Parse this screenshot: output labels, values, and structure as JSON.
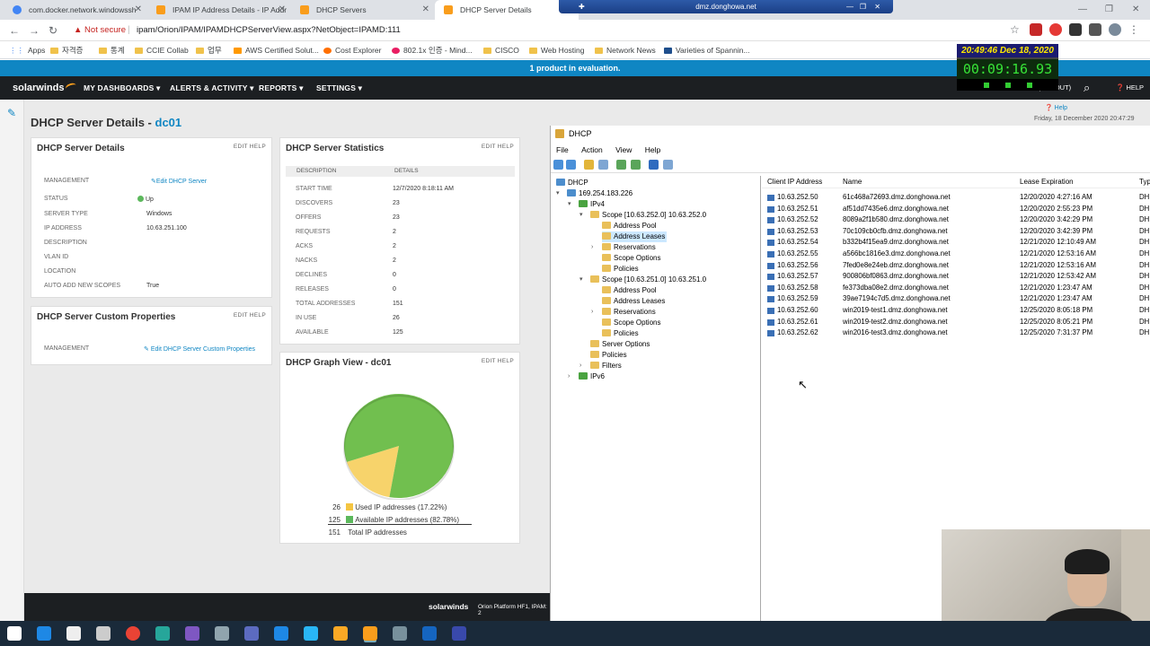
{
  "browser": {
    "tabs": [
      {
        "label": "com.docker.network.windowssh",
        "color": "#4285f4"
      },
      {
        "label": "IPAM IP Address Details - IP Addr",
        "color": "#f99d1c"
      },
      {
        "label": "DHCP Servers",
        "color": "#f99d1c"
      },
      {
        "label": "DHCP Server Details",
        "color": "#f99d1c"
      }
    ],
    "rdp_title": "dmz.donghowa.net",
    "not_secure": "Not secure",
    "url": "ipam/Orion/IPAM/IPAMDHCPServerView.aspx?NetObject=IPAMD:111",
    "bookmarks": [
      "Apps",
      "자격증",
      "통계",
      "CCIE Collab",
      "업무",
      "AWS Certified Solut...",
      "Cost Explorer",
      "802.1x 인증 - Mind...",
      "CISCO",
      "Web Hosting",
      "Network News",
      "Varieties of Spannin..."
    ]
  },
  "clock": {
    "datetime": "20:49:46 Dec 18, 2020",
    "timer": "00:09:16.93"
  },
  "solarwinds": {
    "eval_text": "1 product in evaluation.",
    "logo": "solarwinds",
    "menu": [
      "MY DASHBOARDS",
      "ALERTS & ACTIVITY",
      "REPORTS",
      "SETTINGS"
    ],
    "logout": "N (LOGOUT)",
    "help": "HELP",
    "help_link": "Help",
    "date_line": "Friday, 18 December 2020 20:47:29",
    "page_title": "DHCP Server Details - ",
    "server_name": "dc01",
    "edit_help": "EDIT  HELP",
    "details": {
      "title": "DHCP Server Details",
      "management_label": "MANAGEMENT",
      "management_link": "Edit DHCP Server",
      "rows": [
        {
          "label": "STATUS",
          "value": "Up"
        },
        {
          "label": "SERVER TYPE",
          "value": "Windows"
        },
        {
          "label": "IP ADDRESS",
          "value": "10.63.251.100"
        },
        {
          "label": "DESCRIPTION",
          "value": ""
        },
        {
          "label": "VLAN ID",
          "value": ""
        },
        {
          "label": "LOCATION",
          "value": ""
        },
        {
          "label": "AUTO ADD NEW SCOPES",
          "value": "True"
        }
      ]
    },
    "custom": {
      "title": "DHCP Server Custom Properties",
      "management_label": "MANAGEMENT",
      "management_link": "Edit DHCP Server Custom Properties"
    },
    "stats": {
      "title": "DHCP Server Statistics",
      "col1": "DESCRIPTION",
      "col2": "DETAILS",
      "rows": [
        {
          "label": "START TIME",
          "value": "12/7/2020 8:18:11 AM"
        },
        {
          "label": "DISCOVERS",
          "value": "23"
        },
        {
          "label": "OFFERS",
          "value": "23"
        },
        {
          "label": "REQUESTS",
          "value": "2"
        },
        {
          "label": "ACKS",
          "value": "2"
        },
        {
          "label": "NACKS",
          "value": "2"
        },
        {
          "label": "DECLINES",
          "value": "0"
        },
        {
          "label": "RELEASES",
          "value": "0"
        },
        {
          "label": "TOTAL ADDRESSES",
          "value": "151"
        },
        {
          "label": "IN USE",
          "value": "26"
        },
        {
          "label": "AVAILABLE",
          "value": "125"
        }
      ]
    },
    "graph": {
      "title": "DHCP Graph View - dc01",
      "legend": [
        {
          "count": "26",
          "label": "Used IP addresses (17.22%)",
          "color": "#f4c542"
        },
        {
          "count": "125",
          "label": "Available IP addresses (82.78%)",
          "color": "#5cb85c"
        },
        {
          "count": "151",
          "label": "Total IP addresses",
          "color": ""
        }
      ]
    },
    "footer_logo": "solarwinds",
    "footer_text": "Orion Platform HF1, IPAM: 2"
  },
  "chart_data": {
    "type": "pie",
    "categories": [
      "Used IP addresses",
      "Available IP addresses"
    ],
    "values": [
      26,
      125
    ],
    "colors": [
      "#f7d36b",
      "#71bf4f"
    ]
  },
  "mmc": {
    "title": "DHCP",
    "menu": [
      "File",
      "Action",
      "View",
      "Help"
    ],
    "tree": [
      {
        "label": "DHCP",
        "type": "srv"
      },
      {
        "label": "169.254.183.226",
        "type": "srv"
      },
      {
        "label": "IPv4",
        "type": "green"
      },
      {
        "label": "Scope [10.63.252.0] 10.63.252.0",
        "type": "folder"
      },
      {
        "label": "Address Pool",
        "type": "folder"
      },
      {
        "label": "Address Leases",
        "type": "folder"
      },
      {
        "label": "Reservations",
        "type": "folder"
      },
      {
        "label": "Scope Options",
        "type": "folder"
      },
      {
        "label": "Policies",
        "type": "folder"
      },
      {
        "label": "Scope [10.63.251.0] 10.63.251.0",
        "type": "folder"
      },
      {
        "label": "Address Pool",
        "type": "folder"
      },
      {
        "label": "Address Leases",
        "type": "folder"
      },
      {
        "label": "Reservations",
        "type": "folder"
      },
      {
        "label": "Scope Options",
        "type": "folder"
      },
      {
        "label": "Policies",
        "type": "folder"
      },
      {
        "label": "Server Options",
        "type": "folder"
      },
      {
        "label": "Policies",
        "type": "folder"
      },
      {
        "label": "Filters",
        "type": "folder"
      },
      {
        "label": "IPv6",
        "type": "green"
      }
    ],
    "columns": [
      "Client IP Address",
      "Name",
      "Lease Expiration",
      "Typ"
    ],
    "leases": [
      {
        "ip": "10.63.252.50",
        "name": "61c468a72693.dmz.donghowa.net",
        "exp": "12/20/2020 4:27:16 AM",
        "type": "DH"
      },
      {
        "ip": "10.63.252.51",
        "name": "af51dd7435e6.dmz.donghowa.net",
        "exp": "12/20/2020 2:55:23 PM",
        "type": "DH"
      },
      {
        "ip": "10.63.252.52",
        "name": "8089a2f1b580.dmz.donghowa.net",
        "exp": "12/20/2020 3:42:29 PM",
        "type": "DH"
      },
      {
        "ip": "10.63.252.53",
        "name": "70c109cb0cfb.dmz.donghowa.net",
        "exp": "12/20/2020 3:42:39 PM",
        "type": "DH"
      },
      {
        "ip": "10.63.252.54",
        "name": "b332b4f15ea9.dmz.donghowa.net",
        "exp": "12/21/2020 12:10:49 AM",
        "type": "DH"
      },
      {
        "ip": "10.63.252.55",
        "name": "a566bc1816e3.dmz.donghowa.net",
        "exp": "12/21/2020 12:53:16 AM",
        "type": "DH"
      },
      {
        "ip": "10.63.252.56",
        "name": "7fed0e8e24eb.dmz.donghowa.net",
        "exp": "12/21/2020 12:53:16 AM",
        "type": "DH"
      },
      {
        "ip": "10.63.252.57",
        "name": "900806bf0863.dmz.donghowa.net",
        "exp": "12/21/2020 12:53:42 AM",
        "type": "DH"
      },
      {
        "ip": "10.63.252.58",
        "name": "fe373dba08e2.dmz.donghowa.net",
        "exp": "12/21/2020 1:23:47 AM",
        "type": "DH"
      },
      {
        "ip": "10.63.252.59",
        "name": "39ae7194c7d5.dmz.donghowa.net",
        "exp": "12/21/2020 1:23:47 AM",
        "type": "DH"
      },
      {
        "ip": "10.63.252.60",
        "name": "win2019-test1.dmz.donghowa.net",
        "exp": "12/25/2020 8:05:18 PM",
        "type": "DH"
      },
      {
        "ip": "10.63.252.61",
        "name": "win2019-test2.dmz.donghowa.net",
        "exp": "12/25/2020 8:05:21 PM",
        "type": "DH"
      },
      {
        "ip": "10.63.252.62",
        "name": "win2016-test3.dmz.donghowa.net",
        "exp": "12/25/2020 7:31:37 PM",
        "type": "DH"
      }
    ]
  },
  "taskbar": {
    "icons": [
      "windows-start-icon",
      "ie-icon",
      "explorer-icon",
      "notepad-icon",
      "chrome-icon",
      "app-icon",
      "ipam-icon",
      "tool-icon",
      "settings-icon",
      "file-icon",
      "server-manager-icon",
      "folder-icon",
      "solarwinds-icon",
      "network-icon",
      "azure-icon",
      "powershell-icon"
    ]
  }
}
